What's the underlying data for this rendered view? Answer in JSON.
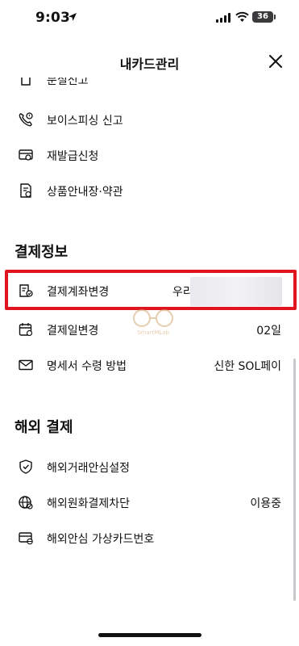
{
  "status_bar": {
    "time": "9:03",
    "battery": "36"
  },
  "header": {
    "title": "내카드관리"
  },
  "card_menu": {
    "items": [
      {
        "label": "분실신고"
      },
      {
        "label": "보이스피싱 신고"
      },
      {
        "label": "재발급신청"
      },
      {
        "label": "상품안내장·약관"
      }
    ]
  },
  "payment_info": {
    "title": "결제정보",
    "items": [
      {
        "label": "결제계좌변경",
        "value": "우리"
      },
      {
        "label": "결제일변경",
        "value": "02일"
      },
      {
        "label": "명세서 수령 방법",
        "value": "신한 SOL페이"
      }
    ]
  },
  "overseas": {
    "title": "해외 결제",
    "items": [
      {
        "label": "해외거래안심설정",
        "value": ""
      },
      {
        "label": "해외원화결제차단",
        "value": "이용중"
      },
      {
        "label": "해외안심 가상카드번호",
        "value": ""
      }
    ]
  },
  "watermark": {
    "text": "SmartMLab"
  },
  "colors": {
    "highlight": "#e0141e",
    "text": "#111111"
  }
}
